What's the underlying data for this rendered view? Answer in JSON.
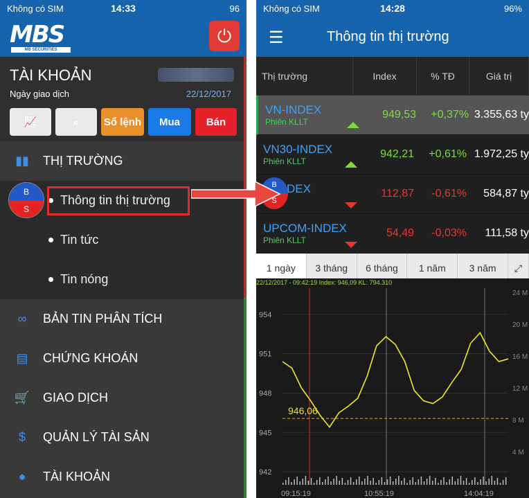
{
  "left": {
    "status": {
      "carrier": "Không có SIM",
      "time": "14:33",
      "battery": "96"
    },
    "logo": {
      "text": "MBS",
      "subtext": "MB SECURITIES"
    },
    "account": {
      "title": "TÀI KHOẢN",
      "sub": "Ngày giao dịch",
      "date": "22/12/2017"
    },
    "buttons": {
      "so_lenh": "Sổ lệnh",
      "mua": "Mua",
      "ban": "Bán"
    },
    "menu": {
      "thi_truong": "THỊ TRƯỜNG",
      "sub": [
        "Thông tin thị trường",
        "Tin tức",
        "Tin nóng"
      ],
      "items": [
        "BẢN TIN PHÂN TÍCH",
        "CHỨNG KHOÁN",
        "GIAO DỊCH",
        "QUẢN LÝ TÀI SẢN",
        "TÀI KHOẢN"
      ]
    },
    "badge": {
      "top": "B",
      "bottom": "S"
    }
  },
  "right": {
    "status": {
      "carrier": "Không có SIM",
      "time": "14:28",
      "battery": "96%"
    },
    "title": "Thông tin thị trường",
    "headers": [
      "Thị trường",
      "Index",
      "% TĐ",
      "Giá trị"
    ],
    "rows": [
      {
        "name": "VN-INDEX",
        "session": "Phiên KLLT",
        "index": "949,53",
        "pct": "+0,37%",
        "value": "3.355,63 ty",
        "dir": "up"
      },
      {
        "name": "VN30-INDEX",
        "session": "Phiên KLLT",
        "index": "942,21",
        "pct": "+0,61%",
        "value": "1.972,25 ty",
        "dir": "up"
      },
      {
        "name": "X-INDEX",
        "session": "KLLT",
        "index": "112,87",
        "pct": "-0,61%",
        "value": "584,87 ty",
        "dir": "down"
      },
      {
        "name": "UPCOM-INDEX",
        "session": "Phiên KLLT",
        "index": "54,49",
        "pct": "-0,03%",
        "value": "111,58 ty",
        "dir": "down"
      }
    ],
    "ranges": [
      "1 ngày",
      "3 tháng",
      "6 tháng",
      "1 năm",
      "3 năm"
    ],
    "badge": {
      "top": "B",
      "bottom": "S"
    }
  },
  "chart_data": {
    "type": "line",
    "header": "22/12/2017 - 09:42:19  Index: 946,09  KL: 794.310",
    "ylabels_left": [
      "954",
      "951",
      "948",
      "945",
      "942"
    ],
    "ylabels_right": [
      "24 M",
      "20 M",
      "16 M",
      "12 M",
      "8 M",
      "4 M"
    ],
    "xlabels": [
      "09:15:19",
      "10:55:19",
      "14:04:19"
    ],
    "reference_label": "946,06",
    "x": [
      "09:15",
      "09:20",
      "09:25",
      "09:30",
      "09:35",
      "09:42",
      "09:50",
      "10:00",
      "10:10",
      "10:20",
      "10:30",
      "10:40",
      "10:50",
      "10:55",
      "11:05",
      "11:15",
      "11:25",
      "13:00",
      "13:10",
      "13:20",
      "13:30",
      "13:40",
      "13:50",
      "14:00",
      "14:04"
    ],
    "values": [
      950.4,
      949.9,
      948.4,
      947.4,
      946.3,
      945.4,
      946.5,
      947.0,
      947.6,
      949.3,
      951.6,
      952.3,
      951.7,
      950.4,
      948.2,
      947.4,
      947.2,
      947.7,
      948.8,
      949.8,
      951.8,
      952.6,
      951.2,
      950.4,
      950.6
    ],
    "ylim": [
      941,
      956
    ]
  }
}
